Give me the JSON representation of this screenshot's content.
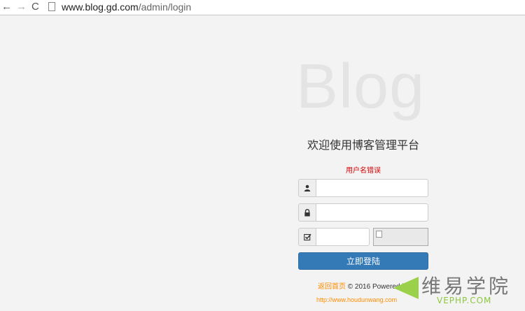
{
  "browser": {
    "back": "←",
    "forward": "→",
    "reload": "C",
    "url_host": "www.blog.gd.com",
    "url_path": "/admin/login"
  },
  "hero": {
    "word": "Blog"
  },
  "form": {
    "title": "欢迎使用博客管理平台",
    "error": "用户名错误",
    "username_value": "",
    "password_value": "",
    "code_value": "",
    "submit_label": "立即登陆"
  },
  "footer": {
    "back_link": "返回首页",
    "text": "© 2016 Powered by",
    "url": "http://www.houdunwang.com"
  },
  "watermark": {
    "cn": "维易学院",
    "en": "VEPHP.COM"
  },
  "icons": [
    "back-arrow-icon",
    "forward-arrow-icon",
    "reload-icon",
    "page-icon",
    "user-icon",
    "lock-icon",
    "checkbox-icon",
    "broken-image-icon"
  ],
  "colors": {
    "primary": "#337ab7",
    "error": "#d40000",
    "link": "#ff8c00"
  }
}
